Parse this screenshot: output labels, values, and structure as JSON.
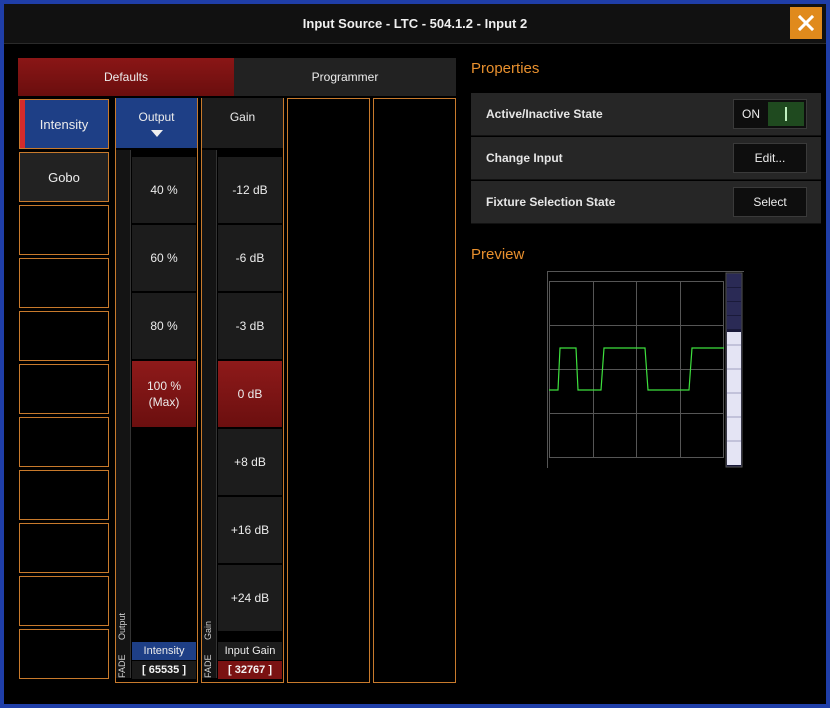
{
  "window": {
    "title": "Input Source - LTC - 504.1.2 - Input 2"
  },
  "tabs": [
    {
      "label": "Defaults",
      "active": true
    },
    {
      "label": "Programmer",
      "active": false
    }
  ],
  "left_list": [
    "Intensity",
    "Gobo",
    "",
    "",
    "",
    "",
    "",
    "",
    "",
    "",
    ""
  ],
  "output_column": {
    "header": "Output",
    "fade_label": "FADE",
    "strip_label": "Output",
    "cells": [
      "40 %",
      "60 %",
      "80 %",
      "100 %\n(Max)"
    ],
    "active_index": 3,
    "footer_label": "Intensity",
    "footer_value": "[ 65535 ]"
  },
  "gain_column": {
    "header": "Gain",
    "fade_label": "FADE",
    "strip_label": "Gain",
    "cells": [
      "-12 dB",
      "-6 dB",
      "-3 dB",
      "0 dB",
      "+8 dB",
      "+16 dB",
      "+24 dB"
    ],
    "active_index": 3,
    "footer_label": "Input Gain",
    "footer_value": "[ 32767 ]"
  },
  "properties": {
    "title": "Properties",
    "rows": [
      {
        "label": "Active/Inactive State",
        "control": "toggle",
        "value": "ON"
      },
      {
        "label": "Change Input",
        "control": "button",
        "value": "Edit..."
      },
      {
        "label": "Fixture Selection State",
        "control": "button",
        "value": "Select"
      }
    ]
  },
  "preview": {
    "title": "Preview"
  },
  "colors": {
    "accent": "#e8902e",
    "border_blue": "#1f3ea8",
    "active_red": "#7a1212",
    "selected_blue": "#1e3f86",
    "waveform": "#3ee03e"
  },
  "icons": {
    "close": "close-icon",
    "toggle": "toggle-switch-icon",
    "dropdown": "triangle-down-icon"
  }
}
